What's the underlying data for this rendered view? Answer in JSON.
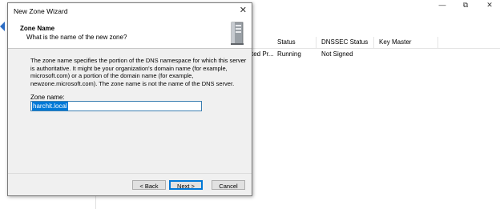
{
  "dialog": {
    "title": "New Zone Wizard",
    "header_title": "Zone Name",
    "header_subtitle": "What is the name of the new zone?",
    "description": "The zone name specifies the portion of the DNS namespace for which this server is authoritative. It might be your organization's domain name (for example, microsoft.com) or a portion of the domain name (for example, newzone.microsoft.com). The zone name is not the name of the DNS server.",
    "field_label": "Zone name:",
    "zone_name_value": "harchit.local",
    "buttons": {
      "back": "< Back",
      "next": "Next >",
      "cancel": "Cancel"
    }
  },
  "background_window": {
    "columns": [
      "Status",
      "DNSSEC Status",
      "Key Master"
    ],
    "row": {
      "truncated_type": "ted Pr...",
      "status": "Running",
      "dnssec": "Not Signed"
    }
  },
  "colors": {
    "accent": "#0078d7",
    "dialog_bg": "#f0f0f0"
  }
}
